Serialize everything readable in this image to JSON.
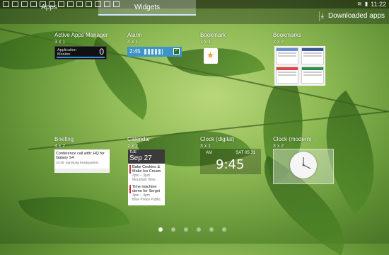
{
  "status_bar": {
    "time": "11:22",
    "icons": [
      "photo-icon",
      "notification-icon",
      "notification-icon",
      "notification-icon",
      "notification-icon",
      "notification-icon",
      "notification-icon",
      "notification-icon",
      "notification-icon",
      "notification-icon",
      "notification-icon",
      "notification-icon",
      "notification-icon",
      "notification-icon",
      "notification-icon",
      "notification-icon",
      "notification-icon"
    ]
  },
  "tabs": [
    {
      "label": "Apps",
      "active": false
    },
    {
      "label": "Widgets",
      "active": true
    }
  ],
  "downloaded_label": "Downloaded apps",
  "widgets": [
    {
      "name": "Active Apps Manager",
      "size": "3 x 1"
    },
    {
      "name": "Alarm",
      "size": "4 x 1"
    },
    {
      "name": "Bookmark",
      "size": "1 x 1"
    },
    {
      "name": "Bookmarks",
      "size": "2 x 2"
    },
    {
      "name": "Briefing",
      "size": "4 x 2"
    },
    {
      "name": "Calendar",
      "size": "2 x 2"
    },
    {
      "name": "Clock (digital)",
      "size": "3 x 1"
    },
    {
      "name": "Clock (modern)",
      "size": "3 x 2"
    }
  ],
  "previews": {
    "active_apps": {
      "line1": "Application",
      "line2": "Monitor",
      "count": "0"
    },
    "alarm": {
      "time": "2:45"
    },
    "briefing": {
      "headline": "Conference call with: HQ for Galaxy S4",
      "sub": "10:30, Samsung headquarters"
    },
    "calendar": {
      "dow": "TUE",
      "date": "Sep 27",
      "events": [
        {
          "title": "Bake Cookies & Make Ice Cream",
          "time": "2pm – 3pm",
          "place": "Mountain View"
        },
        {
          "title": "Time machine demo for Sergei",
          "time": "3pm – 4pm",
          "place": "Blue Police Public"
        }
      ]
    },
    "clock_digital": {
      "ampm": "AM",
      "date": "SAT 05.31",
      "time": "9:45"
    }
  },
  "page_indicator": {
    "count": 6,
    "active_index": 0
  },
  "colors": {
    "tab_highlight": "#cfe7ff",
    "alarm_blue": "#3d94c8"
  }
}
